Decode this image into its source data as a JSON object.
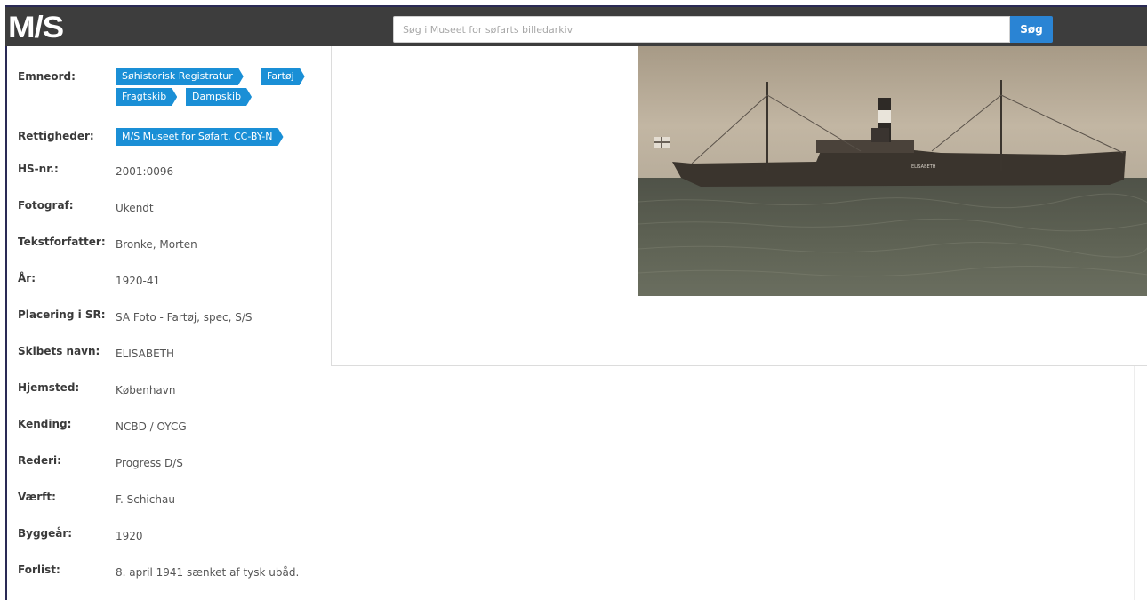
{
  "header": {
    "logo": "M/S",
    "search_placeholder": "Søg i Museet for søfarts billedarkiv",
    "search_button": "Søg"
  },
  "fields": {
    "emneord_label": "Emneord:",
    "emneord_tags": [
      "Søhistorisk Registratur",
      "Fartøj",
      "Fragtskib",
      "Dampskib"
    ],
    "rettigheder_label": "Rettigheder:",
    "rettigheder_tag": "M/S Museet for Søfart, CC-BY-N",
    "hs_label": "HS-nr.:",
    "hs_value": "2001:0096",
    "fotograf_label": "Fotograf:",
    "fotograf_value": "Ukendt",
    "tekst_label": "Tekstforfatter:",
    "tekst_value": "Bronke, Morten",
    "aar_label": "År:",
    "aar_value": "1920-41",
    "placering_label": "Placering i SR:",
    "placering_value": "SA Foto - Fartøj, spec, S/S",
    "skib_label": "Skibets navn:",
    "skib_value": "ELISABETH",
    "hjemsted_label": "Hjemsted:",
    "hjemsted_value": "København",
    "kending_label": "Kending:",
    "kending_value": "NCBD / OYCG",
    "rederi_label": "Rederi:",
    "rederi_value": "Progress D/S",
    "vaerft_label": "Værft:",
    "vaerft_value": "F. Schichau",
    "byggeaar_label": "Byggeår:",
    "byggeaar_value": "1920",
    "forlist_label": "Forlist:",
    "forlist_value": "8. april 1941 sænket af tysk ubåd."
  },
  "photo": {
    "ship_name_on_hull": "ELISABETH"
  },
  "colors": {
    "header_bg": "#3d3d3d",
    "accent": "#1a8fd6",
    "button": "#2a84d4"
  }
}
